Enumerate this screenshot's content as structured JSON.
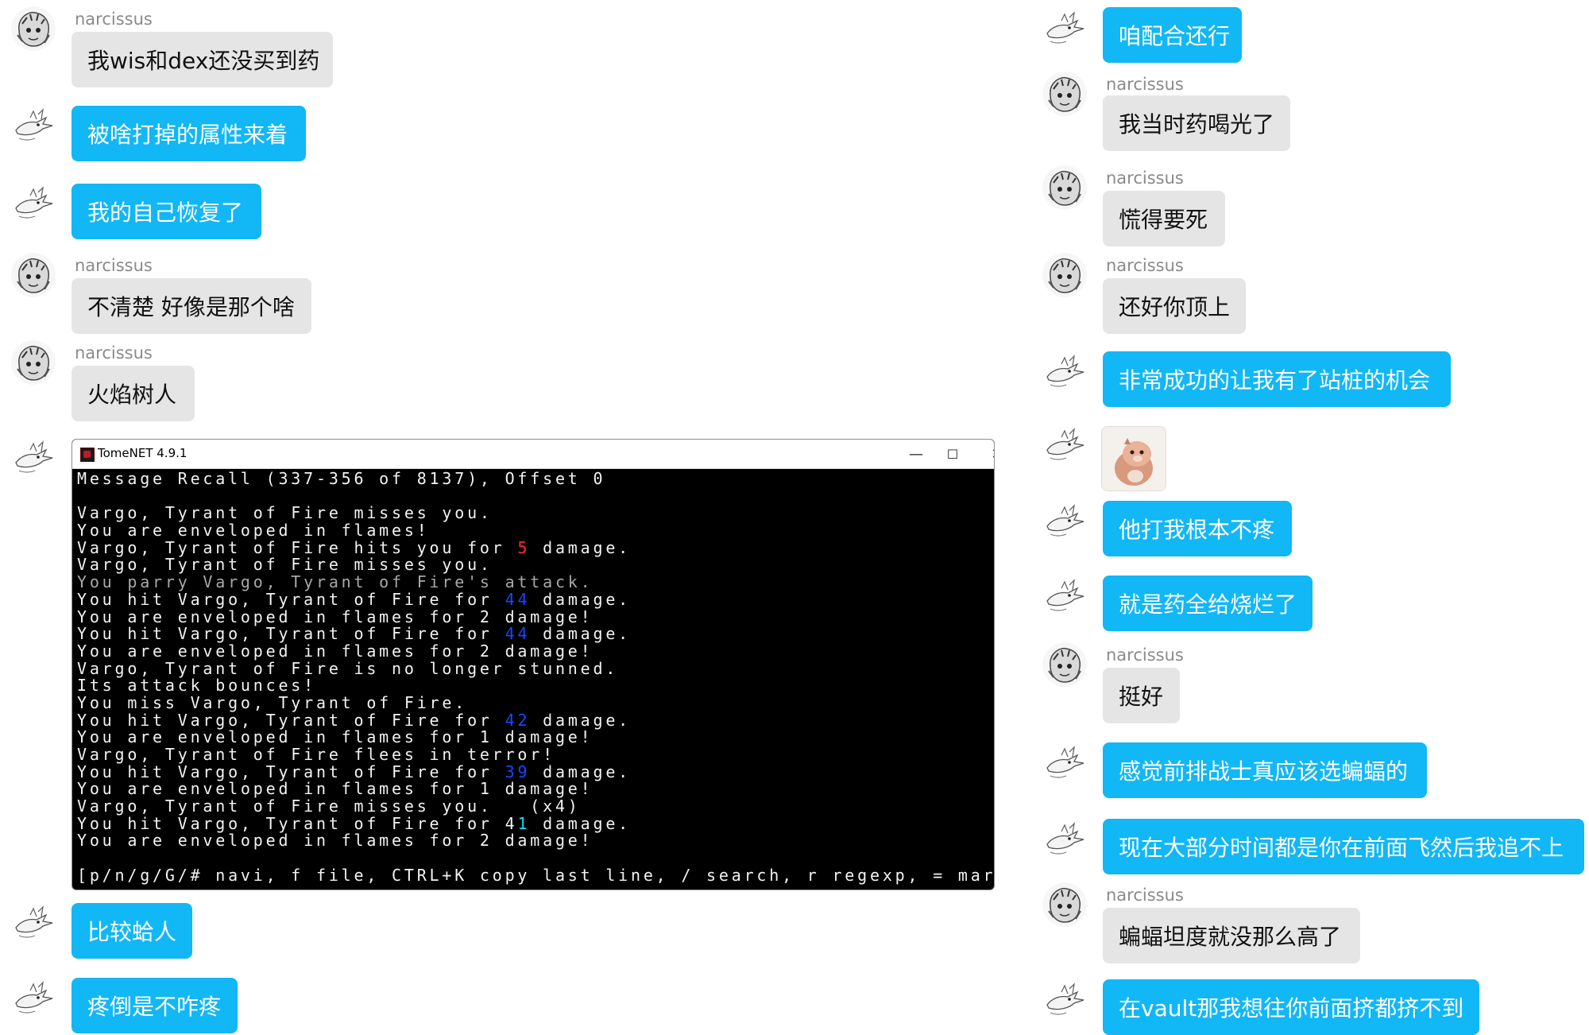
{
  "sender_name": "narcissus",
  "messages": {
    "l1": "我wis和dex还没买到药",
    "l2": "被啥打掉的属性来着",
    "l3": "我的自己恢复了",
    "l4": "不清楚 好像是那个啥",
    "l5": "火焰树人",
    "l6": "比较蛤人",
    "l7": "疼倒是不咋疼",
    "r1": "咱配合还行",
    "r2": "我当时药喝光了",
    "r3": "慌得要死",
    "r4": "还好你顶上",
    "r5": "非常成功的让我有了站桩的机会",
    "r6": "他打我根本不疼",
    "r7": "就是药全给烧烂了",
    "r8": "挺好",
    "r9": "感觉前排战士真应该选蝙蝠的",
    "r10": "现在大部分时间都是你在前面飞然后我追不上",
    "r11": "蝙蝠坦度就没那么高了",
    "r12": "在vault那我想往你前面挤都挤不到"
  },
  "terminal": {
    "title": "TomeNET 4.9.1",
    "controls": {
      "minimize": "—",
      "maximize": "☐",
      "close": "✕"
    },
    "header": "Message Recall (337-356 of 8137), Offset 0",
    "lines": [
      {
        "a": "Vargo, Tyrant of Fire misses you."
      },
      {
        "a": "You are enveloped in flames!"
      },
      {
        "a": "Vargo, Tyrant of Fire hits you for ",
        "n": "5",
        "c": "red",
        "b": " damage."
      },
      {
        "a": "Vargo, Tyrant of Fire misses you."
      },
      {
        "a": "You parry Vargo, Tyrant of Fire's attack.",
        "style": "gray"
      },
      {
        "a": "You hit Vargo, Tyrant of Fire for ",
        "n": "44",
        "c": "blue",
        "b": " damage."
      },
      {
        "a": "You are enveloped in flames for 2 damage!"
      },
      {
        "a": "You hit Vargo, Tyrant of Fire for ",
        "n": "44",
        "c": "blue",
        "b": " damage."
      },
      {
        "a": "You are enveloped in flames for 2 damage!"
      },
      {
        "a": "Vargo, Tyrant of Fire is no longer stunned."
      },
      {
        "a": "Its attack bounces!"
      },
      {
        "a": "You miss Vargo, Tyrant of Fire."
      },
      {
        "a": "You hit Vargo, Tyrant of Fire for ",
        "n": "42",
        "c": "blue",
        "b": " damage."
      },
      {
        "a": "You are enveloped in flames for 1 damage!"
      },
      {
        "a": "Vargo, Tyrant of Fire flees in terror!"
      },
      {
        "a": "You hit Vargo, Tyrant of Fire for ",
        "n": "39",
        "c": "blue",
        "b": " damage."
      },
      {
        "a": "You are enveloped in flames for 1 damage!"
      },
      {
        "a": "Vargo, Tyrant of Fire misses you.   (x4)"
      },
      {
        "a": "You hit Vargo, Tyrant of Fire for 4",
        "n": "1",
        "c": "cyan",
        "b": " damage."
      },
      {
        "a": "You are enveloped in flames for 2 damage!"
      }
    ],
    "footer": "[p/n/g/G/# navi, f file, CTRL+K copy last line, / search, r regexp, = mark, ESC]"
  },
  "colors": {
    "bubble_blue": "#12b7f5",
    "bubble_gray": "#e5e5e5",
    "damage_red": "#ff2b2b",
    "damage_blue": "#1a46ff",
    "damage_cyan": "#1ad8f0"
  }
}
